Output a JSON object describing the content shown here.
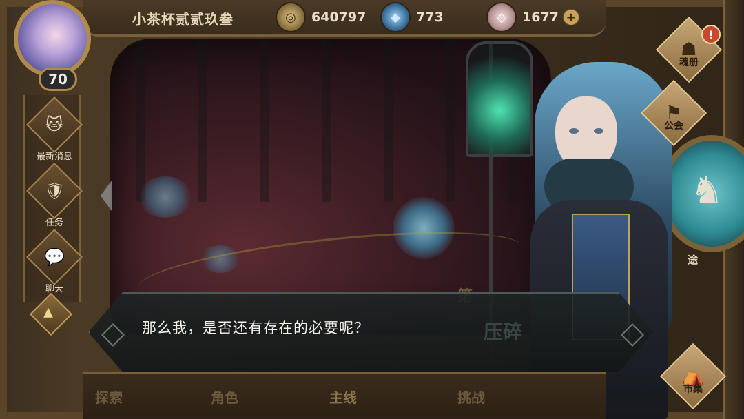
{
  "header": {
    "player_name": "小茶杯贰贰玖叁",
    "level": "70",
    "currencies": [
      {
        "icon": "gold-coin-icon",
        "value": "640797"
      },
      {
        "icon": "blue-crystal-icon",
        "value": "773"
      },
      {
        "icon": "pink-gem-icon",
        "value": "1677"
      }
    ],
    "plus_symbol": "+"
  },
  "left_menu": {
    "items": [
      {
        "label": "最新消息",
        "icon": "cat-icon",
        "glyph": "🐱"
      },
      {
        "label": "任务",
        "icon": "shield-icon",
        "glyph": "🛡"
      },
      {
        "label": "聊天",
        "icon": "chat-bubble-icon",
        "glyph": "💬"
      }
    ],
    "expand_glyph": "▲"
  },
  "right_menu": {
    "items": [
      {
        "label": "魂册",
        "icon": "book-icon",
        "glyph": "☗"
      },
      {
        "label": "公会",
        "icon": "guild-banner-icon",
        "glyph": "⚑"
      },
      {
        "label": "市集",
        "icon": "market-icon",
        "glyph": "⛺"
      }
    ],
    "alert": "!",
    "emblem_label": "途",
    "emblem_glyph": "♞"
  },
  "bottom_tabs": [
    {
      "label": "探索"
    },
    {
      "label": "角色"
    },
    {
      "label": "主线"
    },
    {
      "label": "挑战"
    }
  ],
  "scene_overlay": {
    "chapter_text": "第",
    "title_text": "压碎"
  },
  "dialog": {
    "text": "那么我，是否还有存在的必要呢？"
  },
  "colors": {
    "gold_frame": "#b08c4a",
    "dialog_bg": "#1e2424",
    "dialog_text": "#f1efe9",
    "alert_red": "#c8472d"
  }
}
